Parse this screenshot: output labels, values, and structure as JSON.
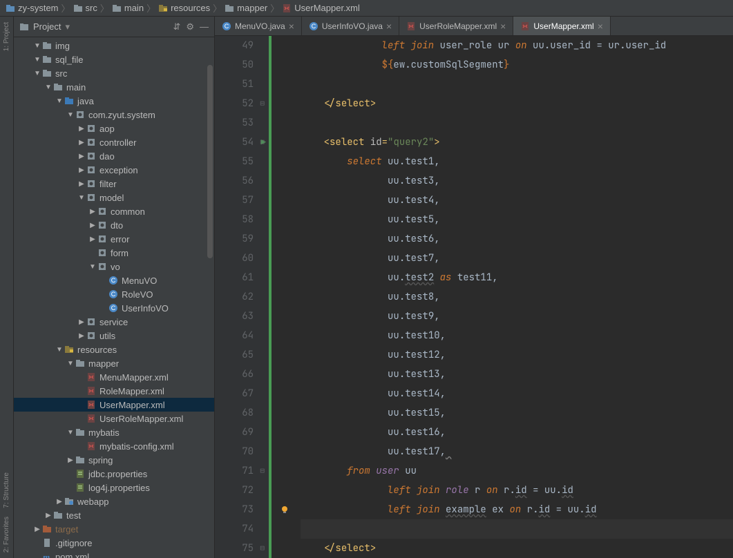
{
  "breadcrumbs": [
    {
      "icon": "folder-module",
      "label": "zy-system"
    },
    {
      "icon": "folder",
      "label": "src"
    },
    {
      "icon": "folder",
      "label": "main"
    },
    {
      "icon": "folder-resources",
      "label": "resources"
    },
    {
      "icon": "folder",
      "label": "mapper"
    },
    {
      "icon": "xml-file",
      "label": "UserMapper.xml"
    }
  ],
  "left_rail": {
    "proj_label": "1: Project",
    "struct_label": "7: Structure",
    "fav_label": "2: Favorites"
  },
  "project_panel": {
    "title": "Project",
    "actions": {
      "expand": "⇵",
      "gear": "⚙",
      "hide": "—"
    }
  },
  "tree": [
    {
      "depth": 1,
      "chev": "v",
      "icon": "folder",
      "label": "img"
    },
    {
      "depth": 1,
      "chev": "v",
      "icon": "folder",
      "label": "sql_file"
    },
    {
      "depth": 1,
      "chev": "v",
      "icon": "folder",
      "label": "src",
      "open": true
    },
    {
      "depth": 2,
      "chev": "v",
      "icon": "folder",
      "label": "main",
      "open": true
    },
    {
      "depth": 3,
      "chev": "v",
      "icon": "folder-src",
      "label": "java",
      "open": true
    },
    {
      "depth": 4,
      "chev": "v",
      "icon": "package",
      "label": "com.zyut.system",
      "open": true
    },
    {
      "depth": 5,
      "chev": ">",
      "icon": "package",
      "label": "aop"
    },
    {
      "depth": 5,
      "chev": ">",
      "icon": "package",
      "label": "controller"
    },
    {
      "depth": 5,
      "chev": ">",
      "icon": "package",
      "label": "dao"
    },
    {
      "depth": 5,
      "chev": ">",
      "icon": "package",
      "label": "exception"
    },
    {
      "depth": 5,
      "chev": ">",
      "icon": "package",
      "label": "filter"
    },
    {
      "depth": 5,
      "chev": "v",
      "icon": "package",
      "label": "model",
      "open": true
    },
    {
      "depth": 6,
      "chev": ">",
      "icon": "package",
      "label": "common"
    },
    {
      "depth": 6,
      "chev": ">",
      "icon": "package",
      "label": "dto"
    },
    {
      "depth": 6,
      "chev": ">",
      "icon": "package",
      "label": "error"
    },
    {
      "depth": 6,
      "chev": "",
      "icon": "package",
      "label": "form"
    },
    {
      "depth": 6,
      "chev": "v",
      "icon": "package",
      "label": "vo",
      "open": true
    },
    {
      "depth": 7,
      "chev": "",
      "icon": "class",
      "label": "MenuVO"
    },
    {
      "depth": 7,
      "chev": "",
      "icon": "class",
      "label": "RoleVO"
    },
    {
      "depth": 7,
      "chev": "",
      "icon": "class",
      "label": "UserInfoVO"
    },
    {
      "depth": 5,
      "chev": ">",
      "icon": "package",
      "label": "service"
    },
    {
      "depth": 5,
      "chev": ">",
      "icon": "package",
      "label": "utils"
    },
    {
      "depth": 3,
      "chev": "v",
      "icon": "folder-resources",
      "label": "resources",
      "open": true
    },
    {
      "depth": 4,
      "chev": "v",
      "icon": "folder",
      "label": "mapper",
      "open": true
    },
    {
      "depth": 5,
      "chev": "",
      "icon": "xml-file",
      "label": "MenuMapper.xml"
    },
    {
      "depth": 5,
      "chev": "",
      "icon": "xml-file",
      "label": "RoleMapper.xml"
    },
    {
      "depth": 5,
      "chev": "",
      "icon": "xml-file",
      "label": "UserMapper.xml",
      "selected": true
    },
    {
      "depth": 5,
      "chev": "",
      "icon": "xml-file",
      "label": "UserRoleMapper.xml"
    },
    {
      "depth": 4,
      "chev": "v",
      "icon": "folder",
      "label": "mybatis",
      "open": true
    },
    {
      "depth": 5,
      "chev": "",
      "icon": "xml-file",
      "label": "mybatis-config.xml"
    },
    {
      "depth": 4,
      "chev": ">",
      "icon": "folder",
      "label": "spring"
    },
    {
      "depth": 4,
      "chev": "",
      "icon": "properties",
      "label": "jdbc.properties"
    },
    {
      "depth": 4,
      "chev": "",
      "icon": "properties",
      "label": "log4j.properties"
    },
    {
      "depth": 3,
      "chev": ">",
      "icon": "folder-web",
      "label": "webapp"
    },
    {
      "depth": 2,
      "chev": ">",
      "icon": "folder",
      "label": "test"
    },
    {
      "depth": 1,
      "chev": ">",
      "icon": "folder-excl",
      "label": "target",
      "dim": true
    },
    {
      "depth": 1,
      "chev": "",
      "icon": "file",
      "label": ".gitignore"
    },
    {
      "depth": 1,
      "chev": "",
      "icon": "maven",
      "label": "pom.xml"
    }
  ],
  "tabs": [
    {
      "icon": "class",
      "label": "MenuVO.java",
      "active": false
    },
    {
      "icon": "class",
      "label": "UserInfoVO.java",
      "active": false
    },
    {
      "icon": "xml-file",
      "label": "UserRoleMapper.xml",
      "active": false
    },
    {
      "icon": "xml-file",
      "label": "UserMapper.xml",
      "active": true
    }
  ],
  "editor": {
    "lines": [
      {
        "n": 49,
        "tokens": [
          [
            "sp",
            14
          ],
          [
            "kw",
            "left join"
          ],
          [
            "ident",
            " user_role ur "
          ],
          [
            "kw",
            "on"
          ],
          [
            "ident",
            " uu"
          ],
          [
            "dot",
            "."
          ],
          [
            "ident",
            "user_id = ur"
          ],
          [
            "dot",
            "."
          ],
          [
            "ident",
            "user_id"
          ]
        ]
      },
      {
        "n": 50,
        "tokens": [
          [
            "sp",
            14
          ],
          [
            "template",
            "${"
          ],
          [
            "ident",
            "ew"
          ],
          [
            "dot",
            "."
          ],
          [
            "ident",
            "customSqlSegment"
          ],
          [
            "template",
            "}"
          ]
        ]
      },
      {
        "n": 51,
        "tokens": []
      },
      {
        "n": 52,
        "fold": true,
        "tokens": [
          [
            "sp",
            4
          ],
          [
            "tag-ang",
            "</"
          ],
          [
            "tag-name",
            "select"
          ],
          [
            "tag-ang",
            ">"
          ]
        ]
      },
      {
        "n": 53,
        "tokens": []
      },
      {
        "n": 54,
        "run": true,
        "fold": true,
        "tokens": [
          [
            "sp",
            4
          ],
          [
            "tag-ang",
            "<"
          ],
          [
            "tag-name",
            "select "
          ],
          [
            "attr-n",
            "id"
          ],
          [
            "tag-ang",
            "="
          ],
          [
            "attr-v",
            "\"query2\""
          ],
          [
            "tag-ang",
            ">"
          ]
        ]
      },
      {
        "n": 55,
        "tokens": [
          [
            "sp",
            8
          ],
          [
            "kw",
            "select"
          ],
          [
            "ident",
            " uu"
          ],
          [
            "dot",
            "."
          ],
          [
            "ident",
            "test1,"
          ]
        ]
      },
      {
        "n": 56,
        "tokens": [
          [
            "sp",
            15
          ],
          [
            "ident",
            "uu"
          ],
          [
            "dot",
            "."
          ],
          [
            "ident",
            "test3,"
          ]
        ]
      },
      {
        "n": 57,
        "tokens": [
          [
            "sp",
            15
          ],
          [
            "ident",
            "uu"
          ],
          [
            "dot",
            "."
          ],
          [
            "ident",
            "test4,"
          ]
        ]
      },
      {
        "n": 58,
        "tokens": [
          [
            "sp",
            15
          ],
          [
            "ident",
            "uu"
          ],
          [
            "dot",
            "."
          ],
          [
            "ident",
            "test5,"
          ]
        ]
      },
      {
        "n": 59,
        "tokens": [
          [
            "sp",
            15
          ],
          [
            "ident",
            "uu"
          ],
          [
            "dot",
            "."
          ],
          [
            "ident",
            "test6,"
          ]
        ]
      },
      {
        "n": 60,
        "tokens": [
          [
            "sp",
            15
          ],
          [
            "ident",
            "uu"
          ],
          [
            "dot",
            "."
          ],
          [
            "ident",
            "test7,"
          ]
        ]
      },
      {
        "n": 61,
        "tokens": [
          [
            "sp",
            15
          ],
          [
            "ident",
            "uu"
          ],
          [
            "dot",
            "."
          ],
          [
            "spell",
            "test2"
          ],
          [
            "ident",
            " "
          ],
          [
            "kw",
            "as"
          ],
          [
            "ident",
            " test11,"
          ]
        ]
      },
      {
        "n": 62,
        "tokens": [
          [
            "sp",
            15
          ],
          [
            "ident",
            "uu"
          ],
          [
            "dot",
            "."
          ],
          [
            "ident",
            "test8,"
          ]
        ]
      },
      {
        "n": 63,
        "tokens": [
          [
            "sp",
            15
          ],
          [
            "ident",
            "uu"
          ],
          [
            "dot",
            "."
          ],
          [
            "ident",
            "test9,"
          ]
        ]
      },
      {
        "n": 64,
        "tokens": [
          [
            "sp",
            15
          ],
          [
            "ident",
            "uu"
          ],
          [
            "dot",
            "."
          ],
          [
            "ident",
            "test10,"
          ]
        ]
      },
      {
        "n": 65,
        "tokens": [
          [
            "sp",
            15
          ],
          [
            "ident",
            "uu"
          ],
          [
            "dot",
            "."
          ],
          [
            "ident",
            "test12,"
          ]
        ]
      },
      {
        "n": 66,
        "tokens": [
          [
            "sp",
            15
          ],
          [
            "ident",
            "uu"
          ],
          [
            "dot",
            "."
          ],
          [
            "ident",
            "test13,"
          ]
        ]
      },
      {
        "n": 67,
        "tokens": [
          [
            "sp",
            15
          ],
          [
            "ident",
            "uu"
          ],
          [
            "dot",
            "."
          ],
          [
            "ident",
            "test14,"
          ]
        ]
      },
      {
        "n": 68,
        "tokens": [
          [
            "sp",
            15
          ],
          [
            "ident",
            "uu"
          ],
          [
            "dot",
            "."
          ],
          [
            "ident",
            "test15,"
          ]
        ]
      },
      {
        "n": 69,
        "tokens": [
          [
            "sp",
            15
          ],
          [
            "ident",
            "uu"
          ],
          [
            "dot",
            "."
          ],
          [
            "ident",
            "test16,"
          ]
        ]
      },
      {
        "n": 70,
        "tokens": [
          [
            "sp",
            15
          ],
          [
            "ident",
            "uu"
          ],
          [
            "dot",
            "."
          ],
          [
            "ident",
            "test17,"
          ],
          [
            "squig",
            " "
          ]
        ]
      },
      {
        "n": 71,
        "fold": true,
        "tokens": [
          [
            "sp",
            8
          ],
          [
            "kw",
            "from"
          ],
          [
            "ident",
            " "
          ],
          [
            "alias",
            "user"
          ],
          [
            "ident",
            " uu"
          ]
        ]
      },
      {
        "n": 72,
        "tokens": [
          [
            "sp",
            15
          ],
          [
            "kw",
            "left join"
          ],
          [
            "ident",
            " "
          ],
          [
            "alias",
            "role"
          ],
          [
            "ident",
            " r "
          ],
          [
            "kw",
            "on"
          ],
          [
            "ident",
            " r"
          ],
          [
            "dot",
            "."
          ],
          [
            "spell",
            "id"
          ],
          [
            "ident",
            " = uu"
          ],
          [
            "dot",
            "."
          ],
          [
            "spell",
            "id"
          ]
        ]
      },
      {
        "n": 73,
        "bulb": true,
        "tokens": [
          [
            "sp",
            15
          ],
          [
            "kw",
            "left join"
          ],
          [
            "ident",
            " "
          ],
          [
            "spell",
            "example"
          ],
          [
            "ident",
            " ex "
          ],
          [
            "kw",
            "on"
          ],
          [
            "ident",
            " r"
          ],
          [
            "dot",
            "."
          ],
          [
            "spell",
            "id"
          ],
          [
            "ident",
            " = uu"
          ],
          [
            "dot",
            "."
          ],
          [
            "spell",
            "id"
          ]
        ]
      },
      {
        "n": 74,
        "current": true,
        "tokens": []
      },
      {
        "n": 75,
        "fold": true,
        "tokens": [
          [
            "sp",
            4
          ],
          [
            "tag-ang",
            "</"
          ],
          [
            "tag-name",
            "select"
          ],
          [
            "tag-ang",
            ">"
          ]
        ]
      }
    ]
  }
}
